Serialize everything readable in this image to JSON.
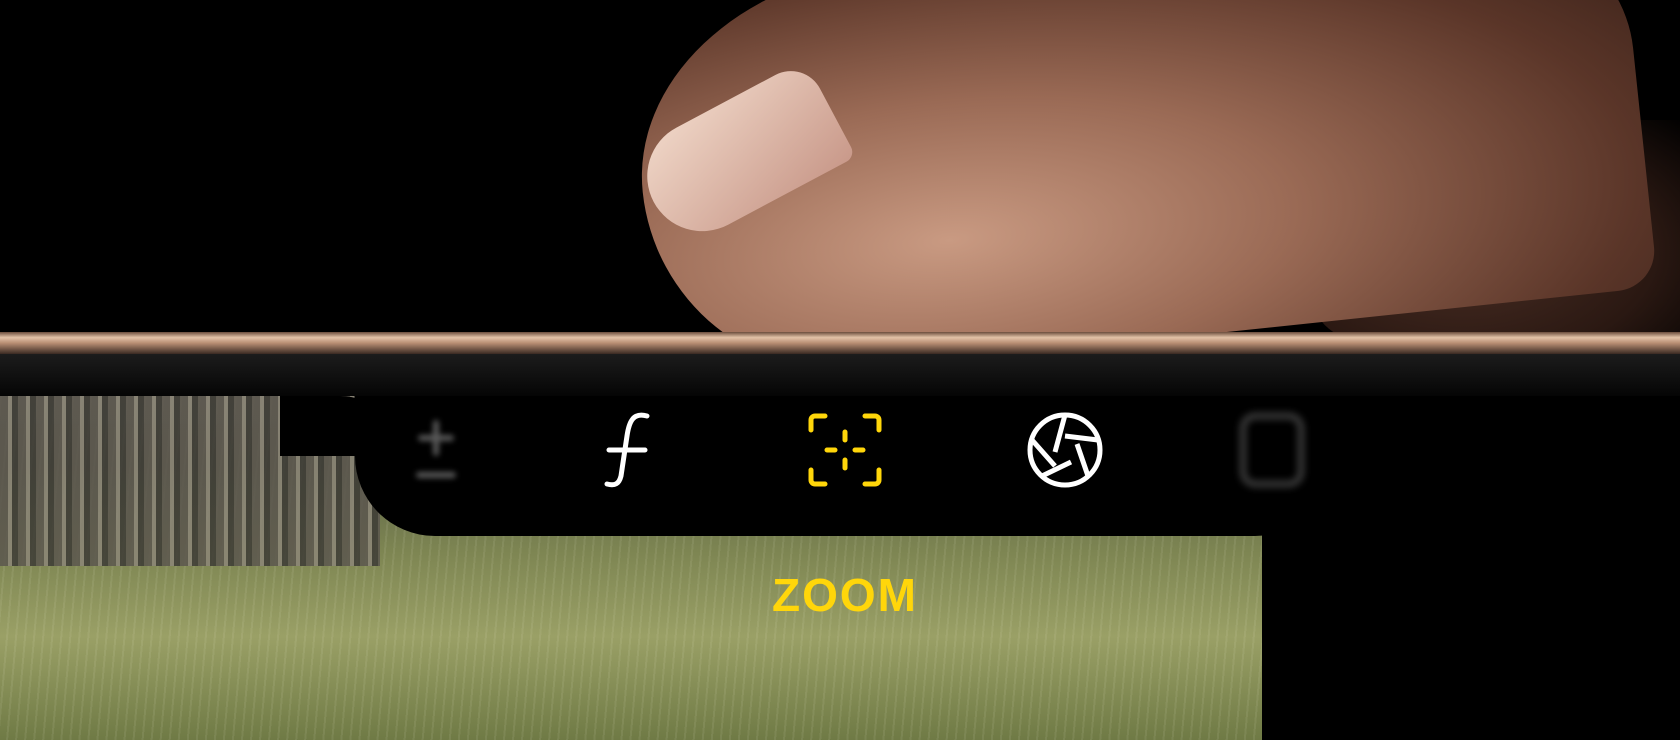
{
  "camera_control": {
    "active_label": "ZOOM",
    "controls": [
      {
        "name": "exposure",
        "icon": "plus-minus-icon",
        "state": "dimmed"
      },
      {
        "name": "depth",
        "icon": "f-stop-icon",
        "state": "normal"
      },
      {
        "name": "zoom",
        "icon": "focus-zoom-icon",
        "state": "selected"
      },
      {
        "name": "cameras",
        "icon": "aperture-icon",
        "state": "normal"
      },
      {
        "name": "styles",
        "icon": "styles-icon",
        "state": "dimmed"
      }
    ]
  },
  "colors": {
    "accent": "#FFD60A",
    "icon": "#FFFFFF",
    "panel": "#000000"
  }
}
